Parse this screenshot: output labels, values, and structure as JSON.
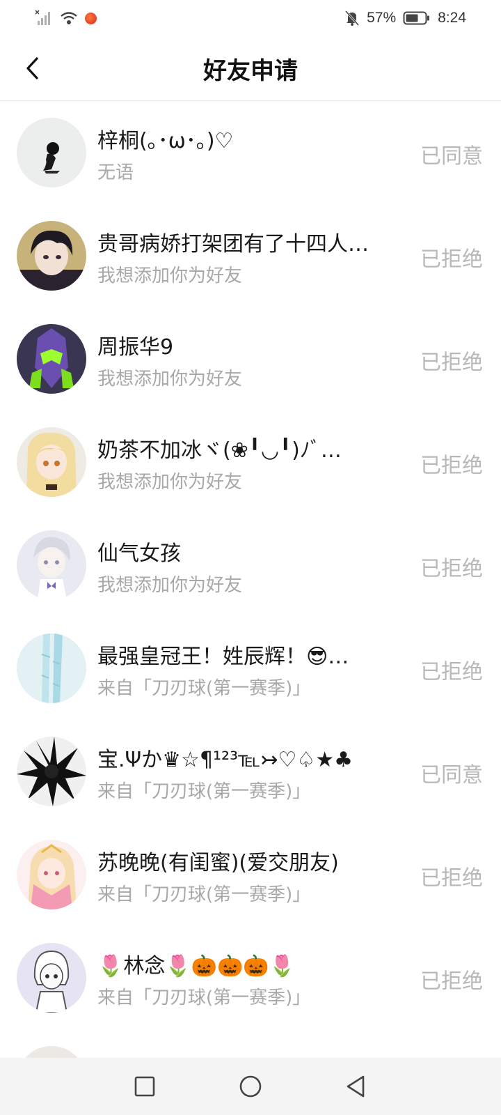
{
  "status_bar": {
    "battery": "57%",
    "time": "8:24",
    "icons": [
      "no-sim-signal-icon",
      "wifi-icon",
      "app-notification-icon",
      "mute-bell-icon",
      "battery-icon"
    ]
  },
  "header": {
    "title": "好友申请",
    "back_icon": "chevron-left-icon"
  },
  "requests": [
    {
      "name": "梓桐(｡･ω･｡)♡",
      "message": "无语",
      "status": "已同意"
    },
    {
      "name": "贵哥病娇打架团有了十四人…",
      "message": "我想添加你为好友",
      "status": "已拒绝"
    },
    {
      "name": "周振华9",
      "message": "我想添加你为好友",
      "status": "已拒绝"
    },
    {
      "name": "奶茶不加冰ヾ(❀╹◡╹)ﾉﾞ…",
      "message": "我想添加你为好友",
      "status": "已拒绝"
    },
    {
      "name": "仙气女孩",
      "message": "我想添加你为好友",
      "status": "已拒绝"
    },
    {
      "name": "最强皇冠王！姓辰辉！😎…",
      "message": "来自「刀刃球(第一赛季)」",
      "status": "已拒绝"
    },
    {
      "name": "宝.Ψか♛☆¶¹²³℡↣♡♤★♣",
      "message": "来自「刀刃球(第一赛季)」",
      "status": "已同意"
    },
    {
      "name": "苏晚晚(有闺蜜)(爱交朋友)",
      "message": "来自「刀刃球(第一赛季)」",
      "status": "已拒绝"
    },
    {
      "name": "🌷林念🌷🎃🎃🎃🌷",
      "message": "来自「刀刃球(第一赛季)」",
      "status": "已拒绝"
    }
  ],
  "nav": {
    "icons": [
      "recent-apps-icon",
      "home-icon",
      "back-icon"
    ]
  }
}
